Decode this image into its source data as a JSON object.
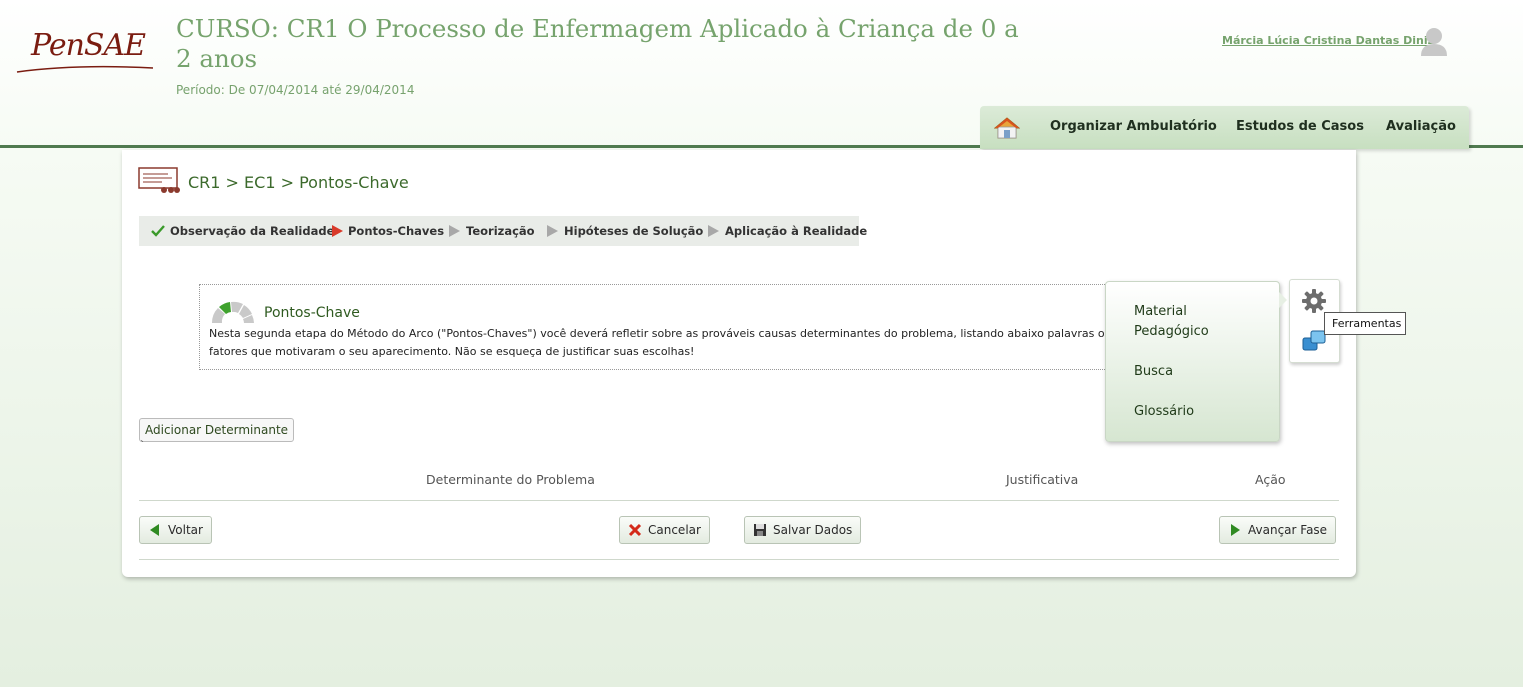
{
  "header": {
    "logo_text": "PenSAE",
    "course_title": "CURSO: CR1 O Processo de Enfermagem Aplicado à Criança de 0 a 2 anos",
    "period": "Período: De 07/04/2014 até 29/04/2014",
    "user_name": "Márcia Lúcia Cristina Dantas Diniz"
  },
  "nav": {
    "items": [
      {
        "label": "Organizar Ambulatório"
      },
      {
        "label": "Estudos de Casos"
      },
      {
        "label": "Avaliação"
      }
    ]
  },
  "breadcrumb": "CR1 > EC1 > Pontos-Chave",
  "steps": [
    {
      "label": "Observação da Realidade",
      "state": "done"
    },
    {
      "label": "Pontos-Chaves",
      "state": "current"
    },
    {
      "label": "Teorização",
      "state": "pending"
    },
    {
      "label": "Hipóteses de Solução",
      "state": "pending"
    },
    {
      "label": "Aplicação à Realidade",
      "state": "pending"
    }
  ],
  "info": {
    "title": "Pontos-Chave",
    "text": "Nesta segunda etapa do Método do Arco (\"Pontos-Chaves\") você deverá refletir sobre as prováveis causas determinantes do problema, listando abaixo palavras ou frases que representem os fatores que motivaram o seu aparecimento. Não se esqueça de justificar suas escolhas!"
  },
  "add_button": "Adicionar Determinante",
  "backtick": "`",
  "table": {
    "columns": [
      "Determinante do Problema",
      "Justificativa",
      "Ação"
    ]
  },
  "buttons": {
    "back": "Voltar",
    "cancel": "Cancelar",
    "save": "Salvar Dados",
    "next": "Avançar Fase"
  },
  "tools": {
    "menu_items": [
      "Material Pedagógico",
      "Busca",
      "Glossário"
    ],
    "tooltip": "Ferramentas"
  },
  "colors": {
    "accent_green": "#76a36d",
    "header_line": "#4f7a4f",
    "logo_red": "#7a1c10"
  }
}
